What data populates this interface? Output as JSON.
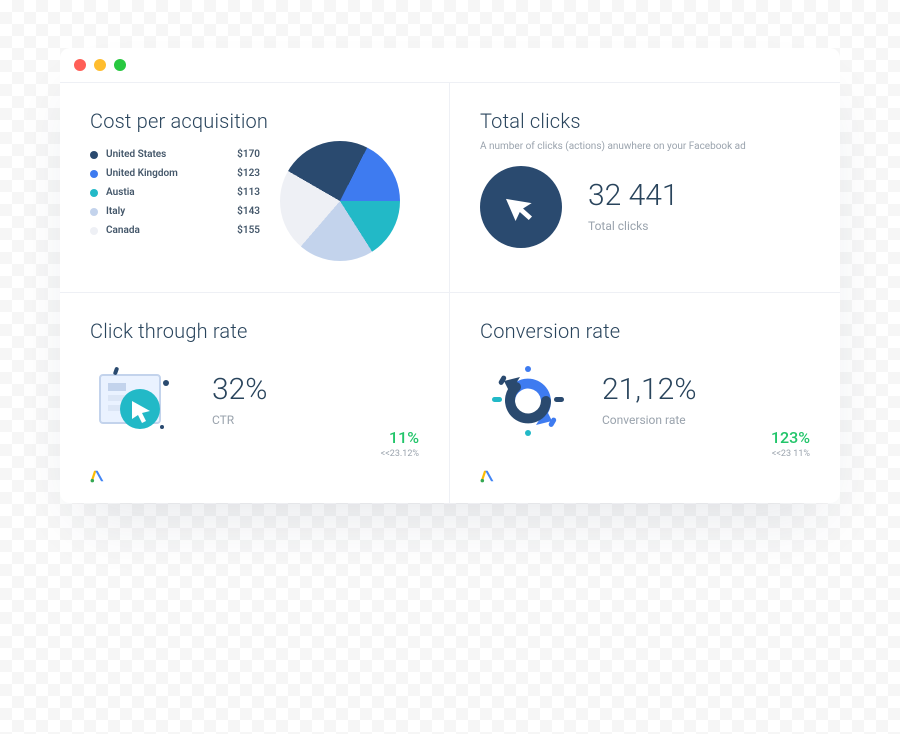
{
  "window": {},
  "cards": {
    "cpa": {
      "title": "Cost per acquisition",
      "legend": [
        {
          "label": "United States",
          "value": "$170",
          "color": "#2a4a6f"
        },
        {
          "label": "United Kingdom",
          "value": "$123",
          "color": "#3e7bf0"
        },
        {
          "label": "Austia",
          "value": "$113",
          "color": "#22b9c7"
        },
        {
          "label": "Italy",
          "value": "$143",
          "color": "#c3d3ec"
        },
        {
          "label": "Canada",
          "value": "$155",
          "color": "#eef0f5"
        }
      ]
    },
    "clicks": {
      "title": "Total clicks",
      "subtitle": "A number of clicks (actions) anuwhere on your Facebook ad",
      "value": "32 441",
      "value_label": "Total clicks"
    },
    "ctr": {
      "title": "Click through rate",
      "value": "32%",
      "value_label": "CTR",
      "delta_pct": "11%",
      "delta_sub": "<<23.12%"
    },
    "conv": {
      "title": "Conversion rate",
      "value": "21,12%",
      "value_label": "Conversion rate",
      "delta_pct": "123%",
      "delta_sub": "<<23 11%"
    }
  },
  "chart_data": {
    "type": "pie",
    "title": "Cost per acquisition",
    "series": [
      {
        "name": "United States",
        "value": 170,
        "color": "#2a4a6f"
      },
      {
        "name": "United Kingdom",
        "value": 123,
        "color": "#3e7bf0"
      },
      {
        "name": "Austia",
        "value": 113,
        "color": "#22b9c7"
      },
      {
        "name": "Italy",
        "value": 143,
        "color": "#c3d3ec"
      },
      {
        "name": "Canada",
        "value": 155,
        "color": "#eef0f5"
      }
    ]
  }
}
